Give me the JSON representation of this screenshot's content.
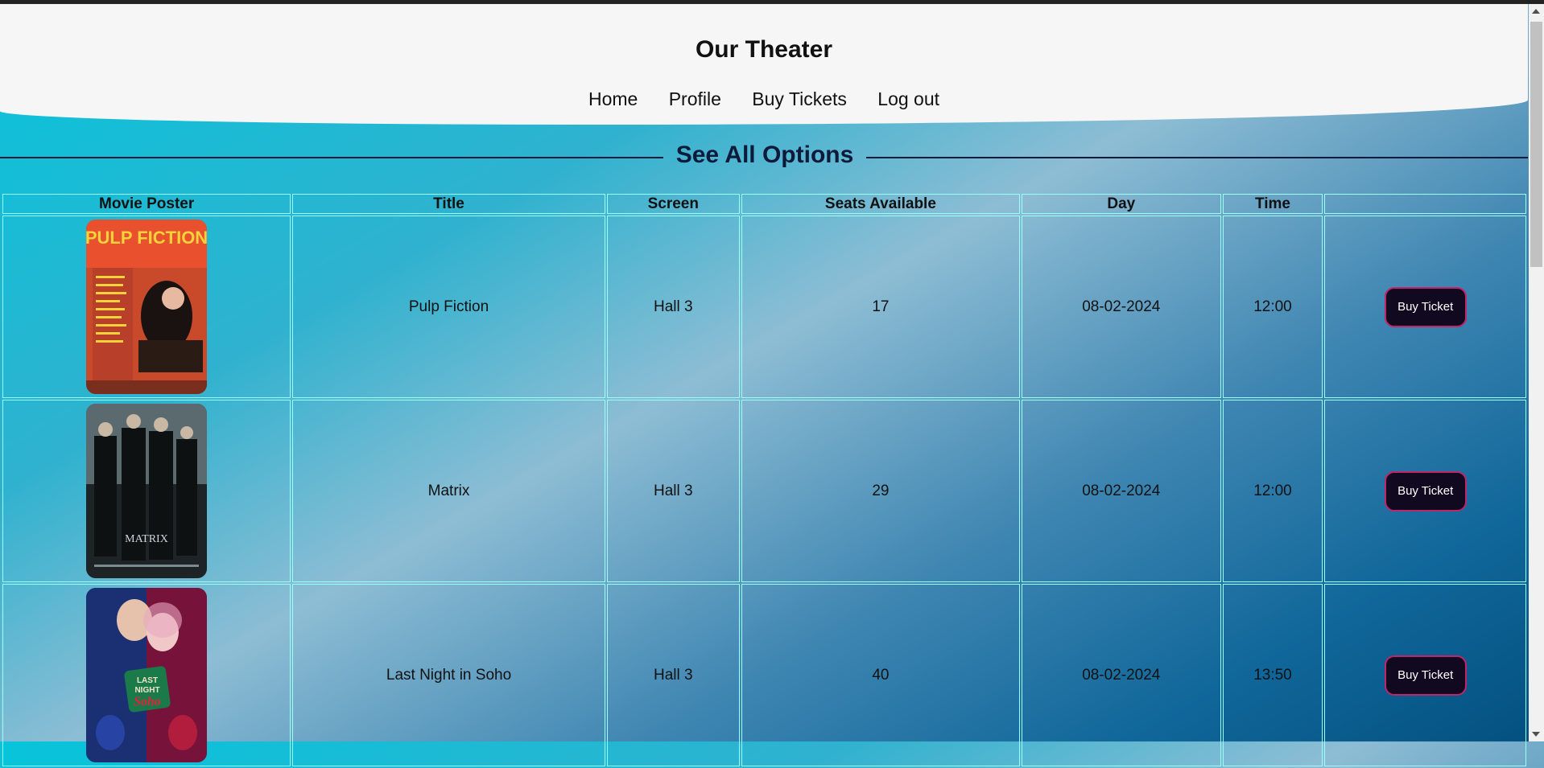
{
  "site": {
    "title": "Our Theater"
  },
  "nav": {
    "items": [
      "Home",
      "Profile",
      "Buy Tickets",
      "Log out"
    ]
  },
  "section": {
    "heading": "See All Options"
  },
  "table": {
    "headers": [
      "Movie Poster",
      "Title",
      "Screen",
      "Seats Available",
      "Day",
      "Time",
      ""
    ],
    "rows": [
      {
        "poster": "pulp-fiction-poster",
        "title": "Pulp Fiction",
        "screen": "Hall 3",
        "seats": "17",
        "day": "08-02-2024",
        "time": "12:00",
        "button": "Buy Ticket"
      },
      {
        "poster": "matrix-poster",
        "title": "Matrix",
        "screen": "Hall 3",
        "seats": "29",
        "day": "08-02-2024",
        "time": "12:00",
        "button": "Buy Ticket"
      },
      {
        "poster": "last-night-in-soho-poster",
        "title": "Last Night in Soho",
        "screen": "Hall 3",
        "seats": "40",
        "day": "08-02-2024",
        "time": "13:50",
        "button": "Buy Ticket"
      }
    ]
  },
  "colors": {
    "header_bg": "#f6f6f6",
    "button_bg": "#10091f",
    "button_border": "#c0246a",
    "cell_border": "#99ffff"
  }
}
